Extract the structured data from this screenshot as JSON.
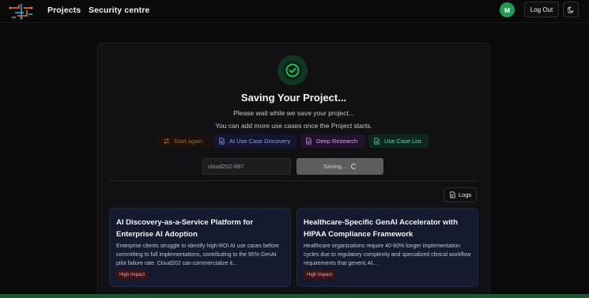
{
  "nav": {
    "projects": "Projects",
    "security": "Security centre"
  },
  "user": {
    "initial": "M",
    "avatar_color": "#1f9d55"
  },
  "header": {
    "logout": "Log Out"
  },
  "status": {
    "title": "Saving Your Project...",
    "message": "Please wait while we save your project...",
    "note": "You can add more use cases once the Project starts."
  },
  "tags": {
    "start_again": "Start again",
    "discovery": "AI Use Case Discovery",
    "research": "Deep Research",
    "list": "Use Case List"
  },
  "project": {
    "name_value": "cloud202-897",
    "saving_label": "Saving..."
  },
  "logs_label": "Logs",
  "use_cases": [
    {
      "title": "AI Discovery-as-a-Service Platform for Enterprise AI Adoption",
      "description": "Enterprise clients struggle to identify high-ROI AI use cases before committing to full implementations, contributing to the 95% GenAI pilot failure rate. Cloud202 can commercialize it...",
      "impact": "High Impact"
    },
    {
      "title": "Healthcare-Specific GenAI Accelerator with HIPAA Compliance Framework",
      "description": "Healthcare organizations require 40-60% longer implementation cycles due to regulatory complexity and specialized clinical workflow requirements that generic AI...",
      "impact": "High Impact"
    }
  ],
  "colors": {
    "success": "#22c55e",
    "discovery": "#8d9bf5",
    "research": "#d39df0",
    "list": "#5fd8b3",
    "start": "#a0682a"
  }
}
